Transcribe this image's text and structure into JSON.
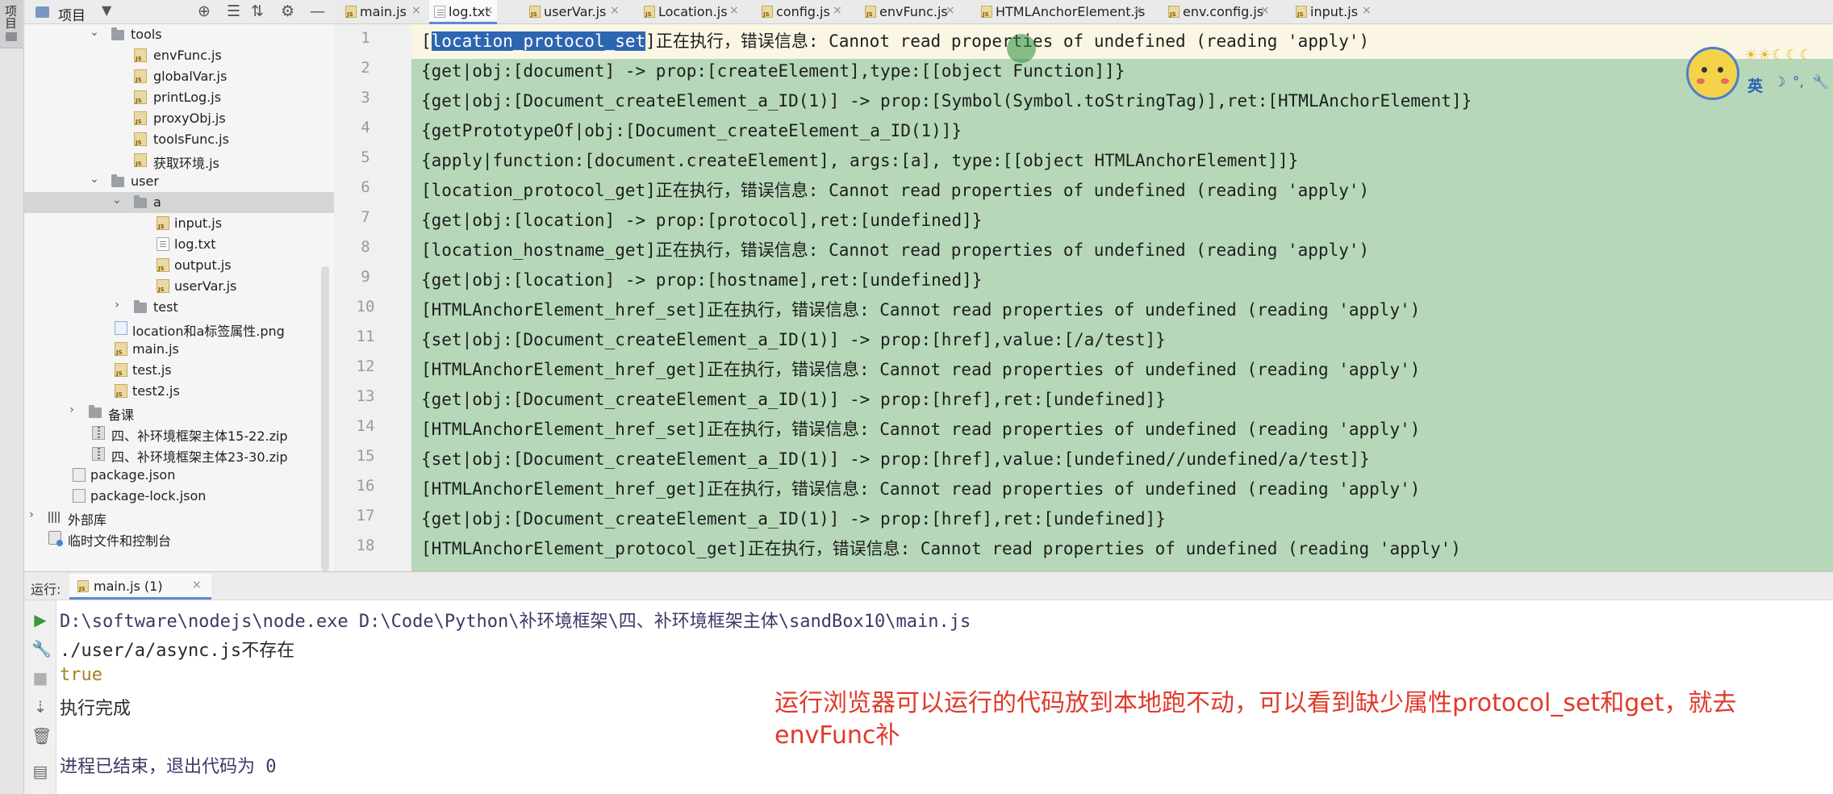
{
  "sidebar_strip": {
    "label": "项目"
  },
  "project_panel": {
    "title": "项目",
    "caret": "▼",
    "tools": [
      "⊕",
      "☰",
      "⇅",
      "⚙",
      "—"
    ]
  },
  "tree": [
    {
      "label": "tools",
      "type": "folder",
      "arrow": "⌄"
    },
    {
      "label": "envFunc.js",
      "type": "js"
    },
    {
      "label": "globalVar.js",
      "type": "js"
    },
    {
      "label": "printLog.js",
      "type": "js"
    },
    {
      "label": "proxyObj.js",
      "type": "js"
    },
    {
      "label": "toolsFunc.js",
      "type": "js"
    },
    {
      "label": "获取环境.js",
      "type": "js"
    },
    {
      "label": "user",
      "type": "folder",
      "arrow": "⌄"
    },
    {
      "label": "a",
      "type": "folder",
      "arrow": "⌄"
    },
    {
      "label": "input.js",
      "type": "js"
    },
    {
      "label": "log.txt",
      "type": "txt"
    },
    {
      "label": "output.js",
      "type": "js"
    },
    {
      "label": "userVar.js",
      "type": "js"
    },
    {
      "label": "test",
      "type": "folder",
      "arrow": "›"
    },
    {
      "label": "location和a标签属性.png",
      "type": "png"
    },
    {
      "label": "main.js",
      "type": "js"
    },
    {
      "label": "test.js",
      "type": "js"
    },
    {
      "label": "test2.js",
      "type": "js"
    },
    {
      "label": "备课",
      "type": "folder",
      "arrow": "›"
    },
    {
      "label": "四、补环境框架主体15-22.zip",
      "type": "zip"
    },
    {
      "label": "四、补环境框架主体23-30.zip",
      "type": "zip"
    },
    {
      "label": "package.json",
      "type": "json"
    },
    {
      "label": "package-lock.json",
      "type": "json"
    },
    {
      "label": "外部库",
      "type": "lib",
      "arrow": "›"
    },
    {
      "label": "临时文件和控制台",
      "type": "scratch"
    }
  ],
  "tabs": [
    {
      "label": "main.js",
      "active": false
    },
    {
      "label": "log.txt",
      "active": true
    },
    {
      "label": "userVar.js",
      "active": false
    },
    {
      "label": "Location.js",
      "active": false
    },
    {
      "label": "config.js",
      "active": false
    },
    {
      "label": "envFunc.js",
      "active": false
    },
    {
      "label": "HTMLAnchorElement.js",
      "active": false
    },
    {
      "label": "env.config.js",
      "active": false
    },
    {
      "label": "input.js",
      "active": false
    }
  ],
  "editor": {
    "line_numbers": [
      "1",
      "2",
      "3",
      "4",
      "5",
      "6",
      "7",
      "8",
      "9",
      "10",
      "11",
      "12",
      "13",
      "14",
      "15",
      "16",
      "17",
      "18"
    ],
    "line1": {
      "open": "[",
      "selected": "location_protocol_set",
      "rest": "]正在执行，错误信息: Cannot read properties of undefined (reading 'apply')"
    },
    "lines": [
      "{get|obj:[document] -> prop:[createElement],type:[[object Function]]}",
      "{get|obj:[Document_createElement_a_ID(1)] -> prop:[Symbol(Symbol.toStringTag)],ret:[HTMLAnchorElement]}",
      "{getPrototypeOf|obj:[Document_createElement_a_ID(1)]}",
      "{apply|function:[document.createElement], args:[a], type:[[object HTMLAnchorElement]]}",
      "[location_protocol_get]正在执行，错误信息: Cannot read properties of undefined (reading 'apply')",
      "{get|obj:[location] -> prop:[protocol],ret:[undefined]}",
      "[location_hostname_get]正在执行，错误信息: Cannot read properties of undefined (reading 'apply')",
      "{get|obj:[location] -> prop:[hostname],ret:[undefined]}",
      "[HTMLAnchorElement_href_set]正在执行，错误信息: Cannot read properties of undefined (reading 'apply')",
      "{set|obj:[Document_createElement_a_ID(1)] -> prop:[href],value:[/a/test]}",
      "[HTMLAnchorElement_href_get]正在执行，错误信息: Cannot read properties of undefined (reading 'apply')",
      "{get|obj:[Document_createElement_a_ID(1)] -> prop:[href],ret:[undefined]}",
      "[HTMLAnchorElement_href_set]正在执行，错误信息: Cannot read properties of undefined (reading 'apply')",
      "{set|obj:[Document_createElement_a_ID(1)] -> prop:[href],value:[undefined//undefined/a/test]}",
      "[HTMLAnchorElement_href_get]正在执行，错误信息: Cannot read properties of undefined (reading 'apply')",
      "{get|obj:[Document_createElement_a_ID(1)] -> prop:[href],ret:[undefined]}",
      "[HTMLAnchorElement_protocol_get]正在执行，错误信息: Cannot read properties of undefined (reading 'apply')"
    ]
  },
  "ime": {
    "row1": "☀☀☾☾☾",
    "lang": "英",
    "symbols": [
      "☽",
      "°,",
      "🔧"
    ]
  },
  "run": {
    "label": "运行:",
    "tab_label": "main.js (1)",
    "close": "×",
    "toolbar_icons": [
      "▶",
      "🔧",
      "■",
      "⇣",
      "🗑",
      "▤"
    ],
    "console_lines": [
      {
        "text": "D:\\software\\nodejs\\node.exe D:\\Code\\Python\\补环境框架\\四、补环境框架主体\\sandBox10\\main.js",
        "kind": "cmd"
      },
      {
        "text": "./user/a/async.js不存在",
        "kind": "out"
      },
      {
        "text": "true",
        "kind": "val"
      },
      {
        "text": "执行完成",
        "kind": "out"
      },
      {
        "text": "",
        "kind": "out"
      },
      {
        "text": "进程已结束，退出代码为 0",
        "kind": "exit"
      }
    ]
  },
  "annotation": "运行浏览器可以运行的代码放到本地跑不动，可以看到缺少属性protocol_set和get，就去envFunc补",
  "colors": {
    "accent": "#5a8ad6",
    "selection": "#2d65b1",
    "diff_bg": "#b6d8b8",
    "annotation": "#e03a2a"
  }
}
